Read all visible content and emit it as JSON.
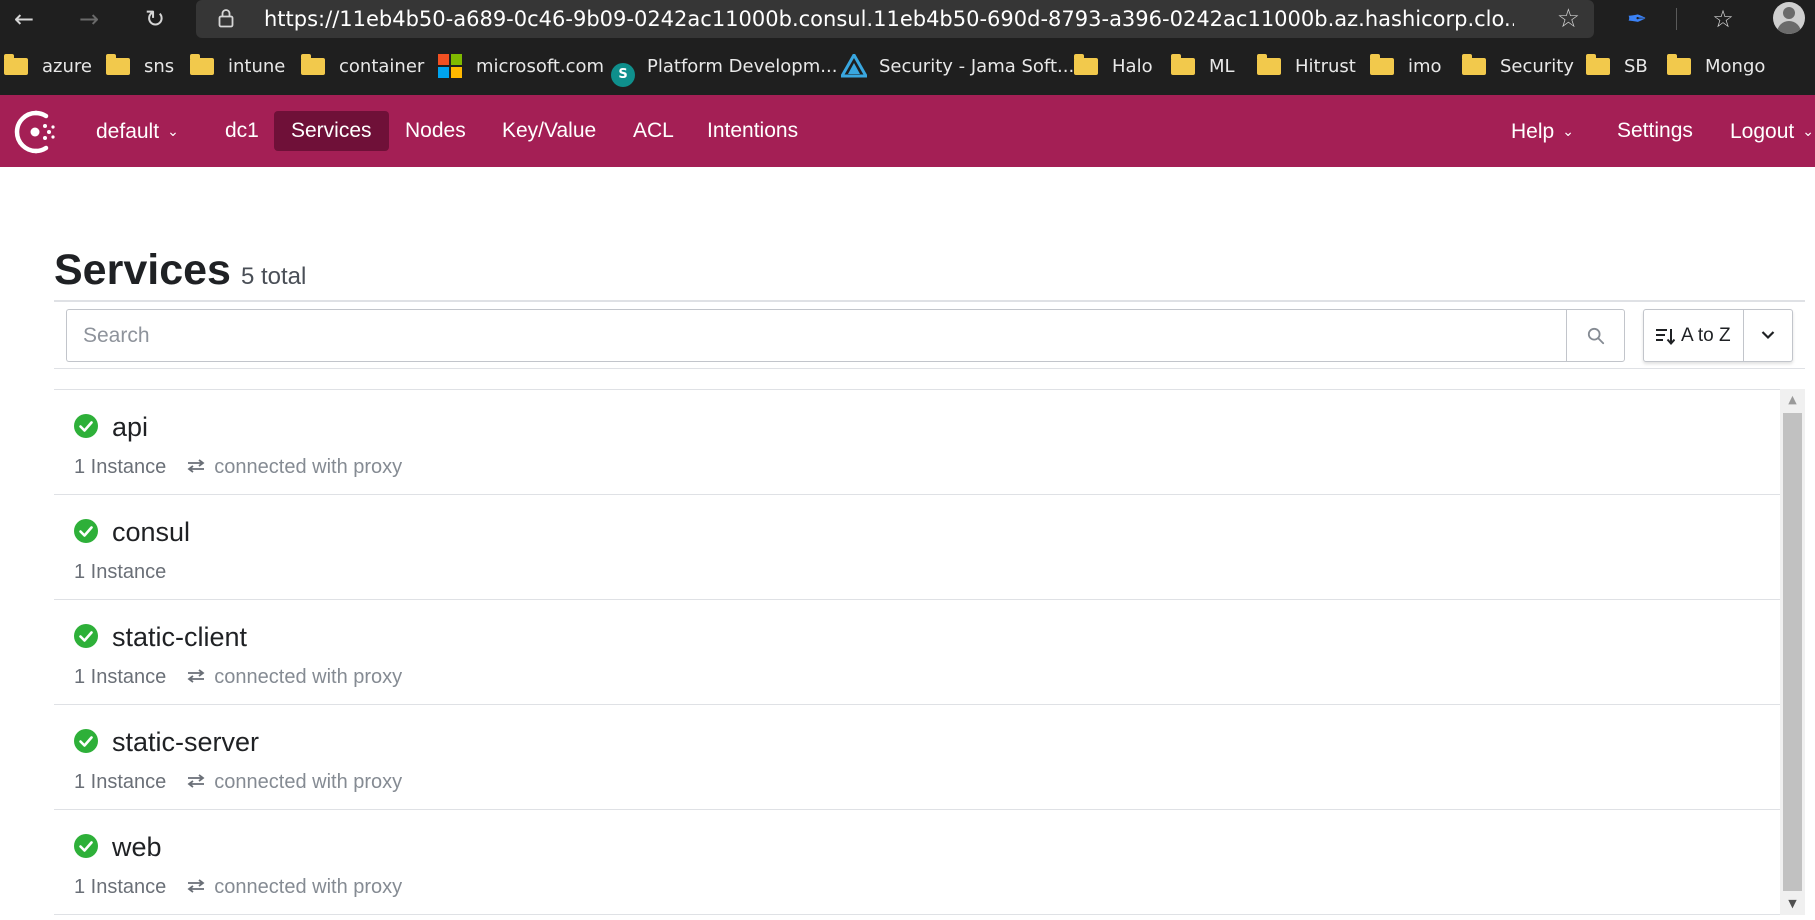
{
  "browser": {
    "url": "https://11eb4b50-a689-0c46-9b09-0242ac11000b.consul.11eb4b50-690d-8793-a396-0242ac11000b.az.hashicorp.clo...",
    "bookmarks": [
      "azure",
      "sns",
      "intune",
      "container",
      "microsoft.com",
      "Platform Developm...",
      "Security - Jama Soft...",
      "Halo",
      "ML",
      "Hitrust",
      "imo",
      "Security",
      "SB",
      "Mongo"
    ]
  },
  "header": {
    "namespace": "default",
    "datacenter": "dc1",
    "nav": [
      "Services",
      "Nodes",
      "Key/Value",
      "ACL",
      "Intentions"
    ],
    "help": "Help",
    "settings": "Settings",
    "logout": "Logout",
    "brand_color": "#a41f55",
    "active_color": "#6f1038"
  },
  "page": {
    "title": "Services",
    "count": "5 total",
    "search_placeholder": "Search",
    "sort_label": "A to Z"
  },
  "services": [
    {
      "name": "api",
      "instances": "1 Instance",
      "proxy": "connected with proxy"
    },
    {
      "name": "consul",
      "instances": "1 Instance",
      "proxy": ""
    },
    {
      "name": "static-client",
      "instances": "1 Instance",
      "proxy": "connected with proxy"
    },
    {
      "name": "static-server",
      "instances": "1 Instance",
      "proxy": "connected with proxy"
    },
    {
      "name": "web",
      "instances": "1 Instance",
      "proxy": "connected with proxy"
    }
  ],
  "colors": {
    "passing": "#2eb039"
  }
}
